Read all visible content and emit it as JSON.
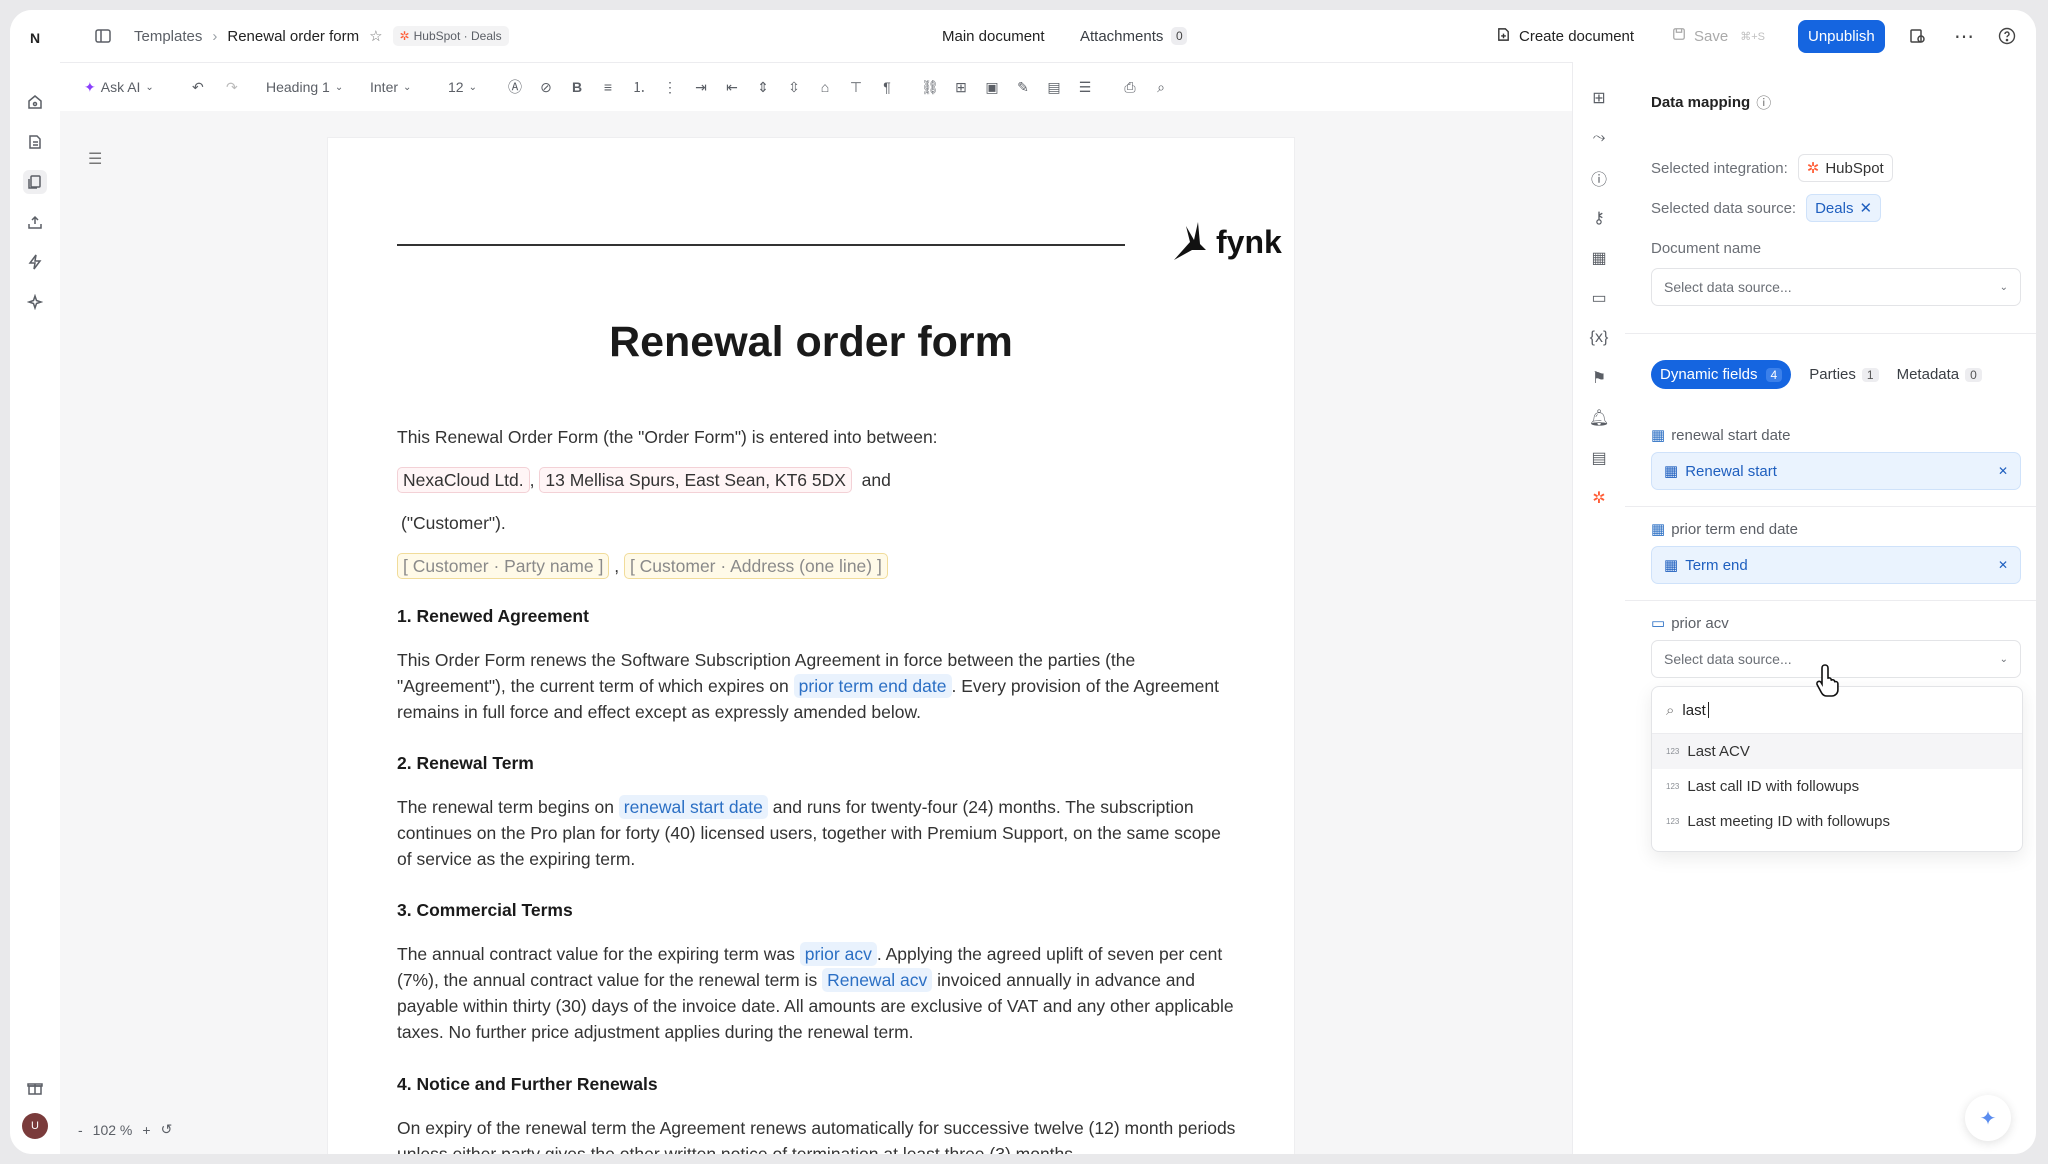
{
  "colors": {
    "accent": "#1565e0",
    "hubspot": "#ff5c35"
  },
  "rail": {
    "logo": "N",
    "icons": [
      "home-icon",
      "document-icon",
      "templates-icon",
      "upload-icon",
      "bolt-icon",
      "sparkle-icon",
      "gift-icon"
    ],
    "avatar": "U"
  },
  "topbar": {
    "breadcrumb_root": "Templates",
    "breadcrumb_current": "Renewal order form",
    "integration_badge": "HubSpot · Deals",
    "tab_main": "Main document",
    "tab_attachments": "Attachments",
    "attachments_count": "0",
    "create_document": "Create document",
    "save": "Save",
    "save_shortcut": "⌘+S",
    "unpublish": "Unpublish"
  },
  "toolbar": {
    "ask_ai": "Ask AI",
    "heading": "Heading 1",
    "font": "Inter",
    "size": "12"
  },
  "document": {
    "brand": "fynk",
    "title": "Renewal order form",
    "intro": "This Renewal Order Form (the \"Order Form\") is entered into between:",
    "party_name": "NexaCloud Ltd.",
    "party_address": "13 Mellisa Spurs, East Sean, KT6 5DX",
    "and": "and",
    "customer": "(\"Customer\").",
    "cust_party_placeholder": "[ Customer · Party name ]",
    "cust_address_placeholder": "[ Customer · Address (one line) ]",
    "s1_heading": "1. Renewed Agreement",
    "s1_a": "This Order Form renews the Software Subscription Agreement in force between the parties (the \"Agreement\"), the current term of which expires on",
    "s1_field": "prior term end date",
    "s1_b": ". Every provision of the Agreement remains in full force and effect except as expressly amended below.",
    "s2_heading": "2. Renewal Term",
    "s2_a": "The renewal term begins on",
    "s2_field": "renewal start date",
    "s2_b": "and runs for twenty-four (24) months. The subscription continues on the Pro plan for forty (40) licensed users, together with Premium Support, on the same scope of service as the expiring term.",
    "s3_heading": "3. Commercial Terms",
    "s3_a": "The annual contract value for the expiring term was",
    "s3_field1": "prior acv",
    "s3_b": ". Applying the agreed uplift of seven per cent (7%), the annual contract value for the renewal term is",
    "s3_field2": "Renewal acv",
    "s3_c": "invoiced annually in advance and payable within thirty (30) days of the invoice date. All amounts are exclusive of VAT and any other applicable taxes. No further price adjustment applies during the renewal term.",
    "s4_heading": "4. Notice and Further Renewals",
    "s4_a": "On expiry of the renewal term the Agreement renews automatically for successive twelve (12) month periods unless either party gives the other written notice of termination at least three (3) months"
  },
  "zoom": {
    "minus": "-",
    "value": "102 %",
    "plus": "+"
  },
  "panel": {
    "title": "Data mapping",
    "selected_integration_label": "Selected integration:",
    "selected_integration": "HubSpot",
    "selected_source_label": "Selected data source:",
    "selected_source": "Deals",
    "document_name_label": "Document name",
    "document_name_placeholder": "Select data source...",
    "tabs": [
      {
        "label": "Dynamic fields",
        "count": "4"
      },
      {
        "label": "Parties",
        "count": "1"
      },
      {
        "label": "Metadata",
        "count": "0"
      }
    ],
    "fields": [
      {
        "label": "renewal start date",
        "value": "Renewal start"
      },
      {
        "label": "prior term end date",
        "value": "Term end"
      },
      {
        "label": "prior acv",
        "placeholder": "Select data source..."
      }
    ],
    "search_value": "last",
    "options": [
      "Last ACV",
      "Last call ID with followups",
      "Last meeting ID with followups"
    ]
  }
}
